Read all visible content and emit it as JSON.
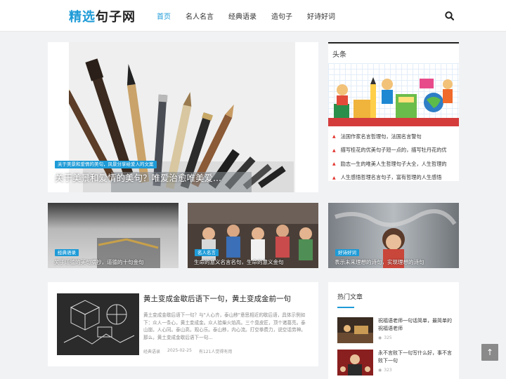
{
  "header": {
    "logo_accent": "精选",
    "logo_rest": "句子网",
    "nav": [
      "首页",
      "名人名言",
      "经典语录",
      "造句子",
      "好诗好词"
    ],
    "search_icon": "search-icon"
  },
  "hero": {
    "tag": "关于美景和爱情的美句，风景分享给爱人的文案",
    "title": "关于美景和爱情的美句？唯爱治愈唯美爱..."
  },
  "sidebar": {
    "title": "头条",
    "items": [
      "法国作家名言哲理句，法国名言警句",
      "描写桂花的优美句子短一点的，描写牡丹花的优",
      "励志一生的唯美人生哲理句子大全，人生哲理的",
      "人生感悟哲理名言句子，富有哲理的人生感悟"
    ]
  },
  "cards": [
    {
      "tag": "经典语录",
      "title": "关于道德的美句摘抄，道德的十句金句"
    },
    {
      "tag": "名人名言",
      "title": "生命的意义名言名句，生命的意义金句"
    },
    {
      "tag": "好诗好词",
      "title": "表示未来理想的诗句，实现理想的诗句"
    }
  ],
  "article": {
    "title": "黄土变成金歇后语下一句，黄土变成金前一句",
    "excerpt": "黄土变成金歇后语下一句？与\"人心齐，泰山移\"意思相近的歇后语，具体示例如下：众人一条心，黄土变成金。众人拾柴火焰高。三个臭皮匠，顶个诸葛亮。泰山崩，人心同。泰山高，观心乐。泰山移，内心流。打空拳费力，说空话劳神。那么，黄土变成金歇后语下一句...",
    "category": "经典语录",
    "date": "2025-02-25",
    "views": "有121人觉得有用"
  },
  "hot": {
    "title": "热门文章",
    "items": [
      {
        "title": "祝福语老师一句话简单，最简单的祝福语老师",
        "views": "325"
      },
      {
        "title": "永不言败下一句写什么好，事不言败下一句",
        "views": "323"
      }
    ]
  },
  "back_top": "↑",
  "colors": {
    "accent": "#1e9bd7",
    "bullet": "#e2322c"
  }
}
